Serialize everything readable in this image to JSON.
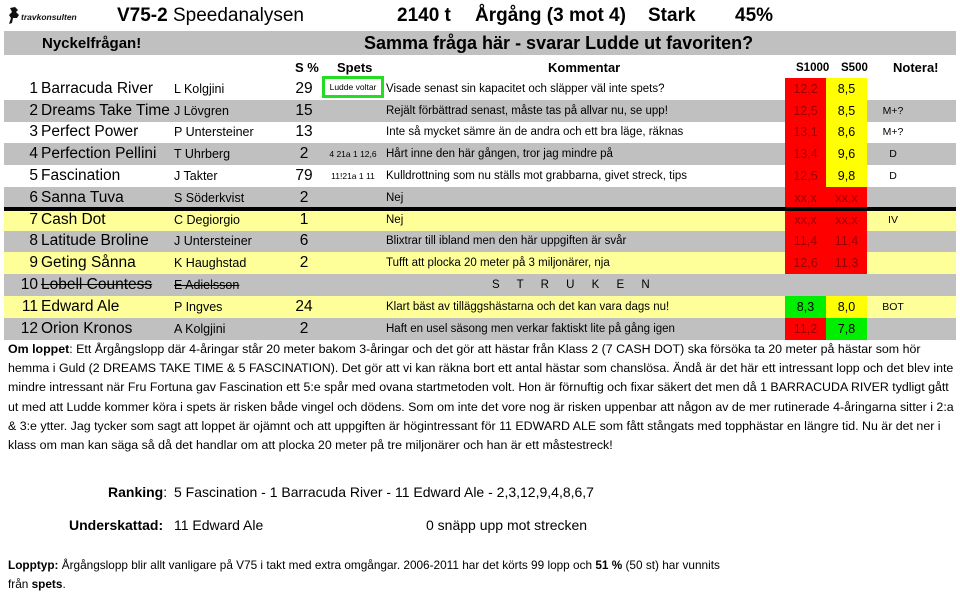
{
  "header": {
    "logo_text": "travkonsulten",
    "race_code": "V75-2",
    "race_title": "Speedanalysen",
    "distance": "2140 t",
    "race_type": "Årgång (3 mot 4)",
    "strength": "Stark",
    "percent": "45%"
  },
  "keyquestion": {
    "label": "Nyckelfrågan!",
    "text": "Samma fråga här - svarar Ludde ut favoriten?"
  },
  "columns": {
    "s_pct": "S %",
    "spets": "Spets",
    "kommentar": "Kommentar",
    "s1000": "S1000",
    "s500": "S500",
    "notera": "Notera!"
  },
  "colors": {
    "row_gray": "#c0c0c0",
    "row_yellow": "#ffff99",
    "red": "#ff0000",
    "yellow": "#ffff00",
    "green": "#00ee00",
    "spets_highlight": "#22dd22"
  },
  "horses": [
    {
      "num": "1",
      "name": "Barracuda River",
      "driver": "L Kolgjini",
      "s_pct": "29",
      "spets": "Ludde voltar",
      "comment": "Visade senast sin kapacitet och släpper väl inte spets?",
      "s1000": "12,2",
      "s1000_color": "red",
      "s500": "8,5",
      "s500_color": "yellow",
      "note": "",
      "scratched": false
    },
    {
      "num": "2",
      "name": "Dreams Take Time",
      "driver": "J Lövgren",
      "s_pct": "15",
      "spets": "",
      "comment": "Rejält förbättrad senast, måste tas på allvar nu, se upp!",
      "s1000": "12,5",
      "s1000_color": "red",
      "s500": "8,5",
      "s500_color": "yellow",
      "note": "M+?",
      "scratched": false
    },
    {
      "num": "3",
      "name": "Perfect Power",
      "driver": "P Untersteiner",
      "s_pct": "13",
      "spets": "",
      "comment": "Inte så mycket sämre än de andra och ett bra läge, räknas",
      "s1000": "13,1",
      "s1000_color": "red",
      "s500": "8,6",
      "s500_color": "yellow",
      "note": "M+?",
      "scratched": false
    },
    {
      "num": "4",
      "name": "Perfection Pellini",
      "driver": "T Uhrberg",
      "s_pct": "2",
      "spets": "4 21a 1 12,6",
      "comment": "Hårt inne den här gången, tror jag mindre på",
      "s1000": "13,4",
      "s1000_color": "red",
      "s500": "9,6",
      "s500_color": "yellow",
      "note": "D",
      "scratched": false
    },
    {
      "num": "5",
      "name": "Fascination",
      "driver": "J Takter",
      "s_pct": "79",
      "spets": "11!21a 1 11",
      "comment": "Kulldrottning som nu ställs mot grabbarna, givet streck, tips",
      "s1000": "12,5",
      "s1000_color": "red",
      "s500": "9,8",
      "s500_color": "yellow",
      "note": "D",
      "scratched": false
    },
    {
      "num": "6",
      "name": "Sanna Tuva",
      "driver": "S Söderkvist",
      "s_pct": "2",
      "spets": "",
      "comment": "Nej",
      "s1000": "xx,x",
      "s1000_color": "red",
      "s500": "xx,x",
      "s500_color": "red",
      "note": "",
      "scratched": false
    },
    {
      "num": "7",
      "name": "Cash Dot",
      "driver": "C Degiorgio",
      "s_pct": "1",
      "spets": "",
      "comment": "Nej",
      "s1000": "xx,x",
      "s1000_color": "red",
      "s500": "xx,x",
      "s500_color": "red",
      "note": "IV",
      "scratched": false
    },
    {
      "num": "8",
      "name": "Latitude Broline",
      "driver": "J Untersteiner",
      "s_pct": "6",
      "spets": "",
      "comment": "Blixtrar till ibland men den här uppgiften är svår",
      "s1000": "11,4",
      "s1000_color": "red",
      "s500": "11,4",
      "s500_color": "red",
      "note": "",
      "scratched": false
    },
    {
      "num": "9",
      "name": "Geting Sånna",
      "driver": "K Haughstad",
      "s_pct": "2",
      "spets": "",
      "comment": "Tufft att plocka 20 meter på 3 miljonärer, nja",
      "s1000": "12,6",
      "s1000_color": "red",
      "s500": "11,3",
      "s500_color": "red",
      "note": "",
      "scratched": false
    },
    {
      "num": "10",
      "name": "Lobell Countess",
      "driver": "E Adielsson",
      "s_pct": "",
      "spets": "",
      "comment": "S T R U K E N",
      "s1000": "",
      "s1000_color": "",
      "s500": "",
      "s500_color": "",
      "note": "",
      "scratched": true
    },
    {
      "num": "11",
      "name": "Edward Ale",
      "driver": "P Ingves",
      "s_pct": "24",
      "spets": "",
      "comment": "Klart bäst av tilläggshästarna och det kan vara dags nu!",
      "s1000": "8,3",
      "s1000_color": "green",
      "s500": "8,0",
      "s500_color": "yellow",
      "note": "BOT",
      "scratched": false
    },
    {
      "num": "12",
      "name": "Orion Kronos",
      "driver": "A Kolgjini",
      "s_pct": "2",
      "spets": "",
      "comment": "Haft en usel säsong men verkar faktiskt lite på gång igen",
      "s1000": "11,2",
      "s1000_color": "red",
      "s500": "7,8",
      "s500_color": "green",
      "note": "",
      "scratched": false
    }
  ],
  "om_loppet": {
    "label": "Om loppet",
    "text": ": Ett Årgångslopp där 4-åringar står 20 meter bakom 3-åringar och det gör att hästar från Klass 2 (7 CASH DOT) ska försöka ta 20 meter på hästar som hör hemma i Guld (2 DREAMS TAKE TIME & 5 FASCINATION). Det gör att vi kan räkna bort ett antal hästar som chanslösa. Ändå är det här ett intressant lopp och det blev inte mindre intressant när Fru Fortuna gav Fascination ett 5:e spår med ovana startmetoden volt. Hon är förnuftig och fixar säkert det men då 1 BARRACUDA RIVER tydligt gått ut med att Ludde kommer köra i spets är risken både vingel och dödens. Som om inte det vore nog är risken uppenbar att någon av de mer rutinerade 4-åringarna sitter i 2:a & 3:e ytter. Jag tycker som sagt att loppet är ojämnt och att uppgiften är högintressant för 11 EDWARD ALE som fått stångats med topphästar en längre tid. Nu är det ner i klass om man kan säga så då det handlar om att plocka 20 meter på tre miljonärer och han är ett måstestreck!"
  },
  "ranking": {
    "label": "Ranking",
    "text": "5 Fascination - 1 Barracuda River - 11 Edward Ale - 2,3,12,9,4,8,6,7"
  },
  "underskattad": {
    "label": "Underskattad:",
    "text": "11 Edward Ale",
    "note": "0 snäpp upp mot strecken"
  },
  "lopptyp": {
    "label": "Lopptyp:",
    "text_a": " Årgångslopp blir allt vanligare på V75 i takt med extra omgångar. 2006-2011 har det körts 99 lopp och ",
    "pct": "51 %",
    "text_b": " (50 st) har vunnits från ",
    "spets": "spets",
    "end": "."
  }
}
